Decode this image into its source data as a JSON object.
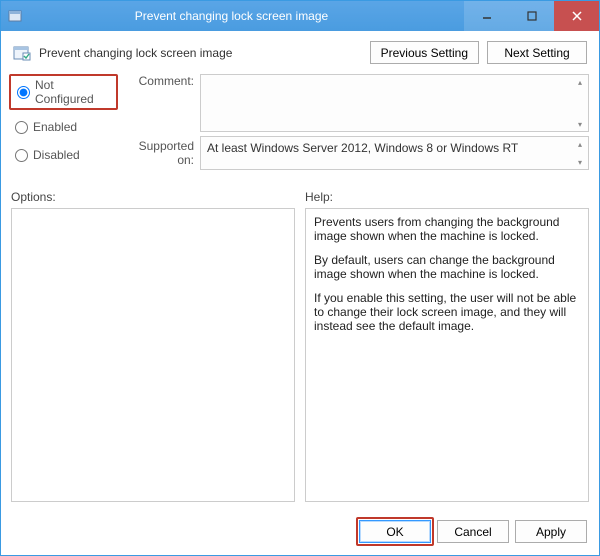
{
  "window": {
    "title": "Prevent changing lock screen image"
  },
  "header": {
    "policy_title": "Prevent changing lock screen image",
    "previous_btn": "Previous Setting",
    "next_btn": "Next Setting"
  },
  "config": {
    "not_configured": "Not Configured",
    "enabled": "Enabled",
    "disabled": "Disabled",
    "comment_label": "Comment:",
    "comment_value": "",
    "supported_label": "Supported on:",
    "supported_value": "At least Windows Server 2012, Windows 8 or Windows RT"
  },
  "lower": {
    "options_label": "Options:",
    "help_label": "Help:",
    "help_p1": "Prevents users from changing the background image shown when the machine is locked.",
    "help_p2": "By default, users can change the background image shown when the machine is locked.",
    "help_p3": "If you enable this setting, the user will not be able to change their lock screen image, and they will instead see the default image."
  },
  "footer": {
    "ok": "OK",
    "cancel": "Cancel",
    "apply": "Apply"
  }
}
